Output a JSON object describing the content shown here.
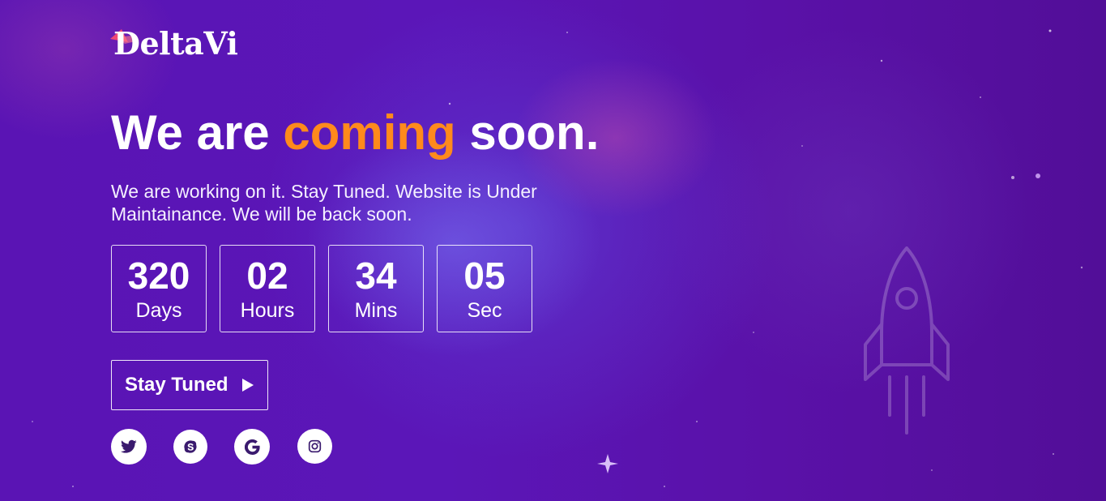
{
  "brand": {
    "logo_text": "DeltaVi",
    "accent_color": "#ff8a1c",
    "logo_mark_color": "#ff4d6d"
  },
  "hero": {
    "headline_before": "We are",
    "headline_accent": "coming",
    "headline_after": "soon.",
    "subtitle": "We are working on it. Stay Tuned. Website is Under Maintainance. We will be back soon."
  },
  "countdown": [
    {
      "value": "320",
      "label": "Days"
    },
    {
      "value": "02",
      "label": "Hours"
    },
    {
      "value": "34",
      "label": "Mins"
    },
    {
      "value": "05",
      "label": "Sec"
    }
  ],
  "cta": {
    "label": "Stay Tuned",
    "icon": "play-triangle-icon"
  },
  "social": [
    {
      "name": "twitter",
      "icon": "twitter-icon"
    },
    {
      "name": "skype",
      "icon": "skype-icon"
    },
    {
      "name": "google",
      "icon": "google-icon"
    },
    {
      "name": "instagram",
      "icon": "instagram-icon"
    }
  ],
  "decor": {
    "rocket_icon": "rocket-icon"
  }
}
